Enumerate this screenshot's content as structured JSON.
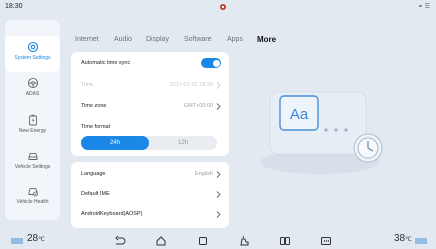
{
  "status": {
    "time": "18:30",
    "right_icons": "⚭ ☰"
  },
  "sidebar": {
    "items": [
      {
        "label": "System Settings",
        "icon": "gear-icon",
        "active": true
      },
      {
        "label": "ADAS",
        "icon": "steering-wheel-icon"
      },
      {
        "label": "New Energy",
        "icon": "battery-icon"
      },
      {
        "label": "Vehicle Settings",
        "icon": "car-icon"
      },
      {
        "label": "Vehicle Health",
        "icon": "car-health-icon"
      }
    ]
  },
  "tabs": [
    {
      "label": "Internet"
    },
    {
      "label": "Audio"
    },
    {
      "label": "Display"
    },
    {
      "label": "Software"
    },
    {
      "label": "Apps"
    },
    {
      "label": "More",
      "active": true
    }
  ],
  "time_card": {
    "auto_sync_label": "Automatic time sync",
    "auto_sync_on": true,
    "time_label": "Time",
    "time_value": "2017-01-01 18:30",
    "timezone_label": "Time zone",
    "timezone_value": "GMT+00:00",
    "format_label": "Time format",
    "format_options": [
      "24h",
      "12h"
    ],
    "format_selected": "24h"
  },
  "lang_card": {
    "language_label": "Language",
    "language_value": "English",
    "ime_label": "Default IME",
    "keyboard_label": "AndroidKeyboard(AOSP)"
  },
  "illustration": {
    "letters": "Aa"
  },
  "bottom": {
    "temp_left": "28",
    "temp_left_unit": "℃",
    "temp_right": "38",
    "temp_right_unit": "℃"
  },
  "colors": {
    "accent": "#1b87e6",
    "background": "#e3e9f0",
    "card": "#ffffff"
  }
}
